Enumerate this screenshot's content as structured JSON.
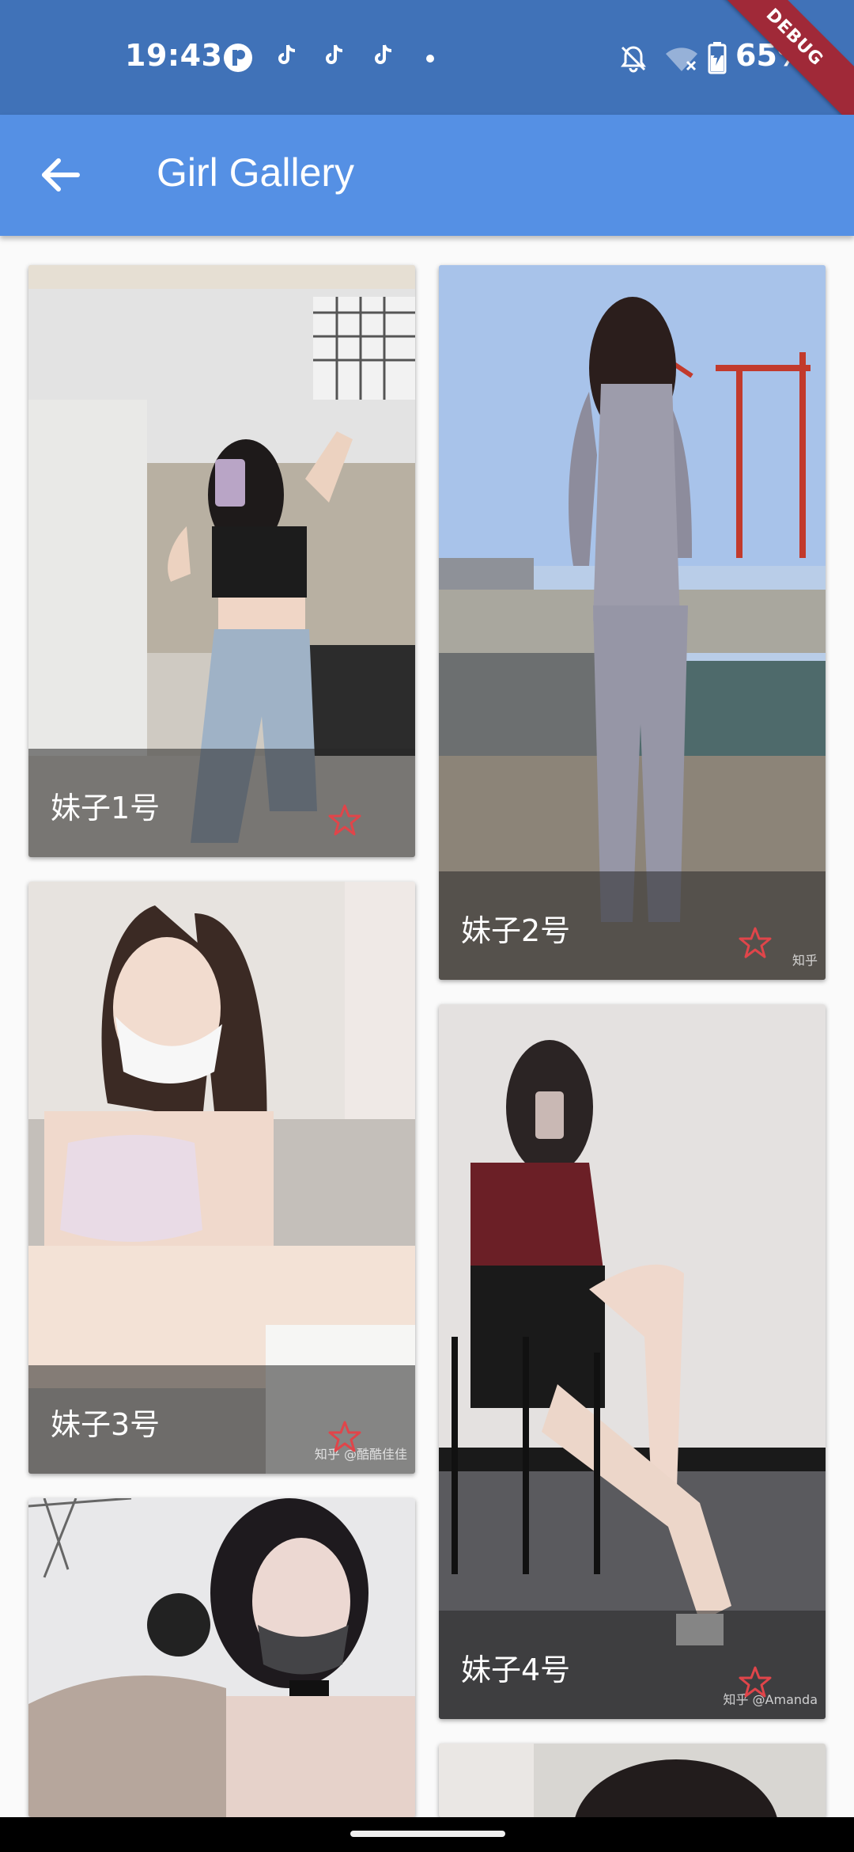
{
  "status_bar": {
    "time": "19:43",
    "battery": "65%",
    "debug_label": "DEBUG",
    "icons": [
      "app-r-icon",
      "tiktok-icon",
      "tiktok-icon",
      "tiktok-icon",
      "dot-icon",
      "bell-off-icon",
      "wifi-off-icon",
      "battery-charging-icon"
    ]
  },
  "app_bar": {
    "title": "Girl Gallery",
    "back_icon": "arrow-left-icon"
  },
  "gallery": {
    "items": [
      {
        "title": "妹子1号",
        "watermark": "",
        "starred": false
      },
      {
        "title": "妹子2号",
        "watermark": "知乎",
        "starred": false
      },
      {
        "title": "妹子3号",
        "watermark": "知乎 @酷酷佳佳",
        "starred": false
      },
      {
        "title": "妹子4号",
        "watermark": "知乎 @Amanda",
        "starred": false
      }
    ]
  },
  "colors": {
    "status_bar": "#4072b8",
    "app_bar": "#5590e4",
    "star": "#e0454a",
    "debug": "#a02938"
  }
}
